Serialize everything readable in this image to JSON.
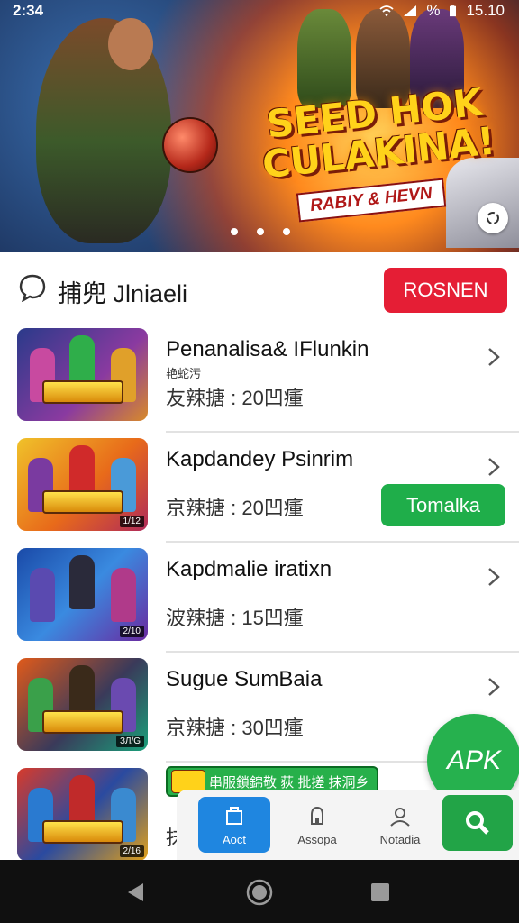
{
  "status_bar": {
    "time": "2:34",
    "battery": "%",
    "clock": "15.10"
  },
  "banner": {
    "title": "SEED HOK CULAKINA!",
    "subtitle": "RABIY & HEVN"
  },
  "section": {
    "title": "捕兜 Jlniaeli",
    "button_label": "ROSNEN"
  },
  "games": [
    {
      "title": "Penanalisa& IFlunkin",
      "subtitle": "艳蛇汚",
      "meta": "友辣搪 : 20凹瘇",
      "thumb_tag": ""
    },
    {
      "title": "Kapdandey Psinrim",
      "subtitle": "",
      "meta": "京辣搪 : 20凹瘇",
      "thumb_tag": "1/12",
      "action_label": "Tomalka"
    },
    {
      "title": "Kapdmalie iratixn",
      "subtitle": "",
      "meta": "波辣搪 : 15凹瘇",
      "thumb_tag": "2/10"
    },
    {
      "title": "Sugue SumBaia",
      "subtitle": "",
      "meta": "京辣搪 : 30凹瘇",
      "thumb_tag": "ЗЛ/G"
    },
    {
      "title": "",
      "subtitle": "",
      "meta": "抹萘",
      "thumb_tag": "2/16"
    }
  ],
  "promo": {
    "label": "串服鎖錦敬 荻 批搓 抹洞乡"
  },
  "apk_fab": {
    "label": "APK"
  },
  "bottom_nav": [
    {
      "label": "Aoct",
      "icon": "home-icon",
      "active": true
    },
    {
      "label": "Assopa",
      "icon": "bell-icon",
      "active": false
    },
    {
      "label": "Notadia",
      "icon": "profile-icon",
      "active": false
    }
  ],
  "colors": {
    "primary_red": "#e51e35",
    "primary_green": "#1fae4a",
    "nav_active_blue": "#1f86e0"
  }
}
